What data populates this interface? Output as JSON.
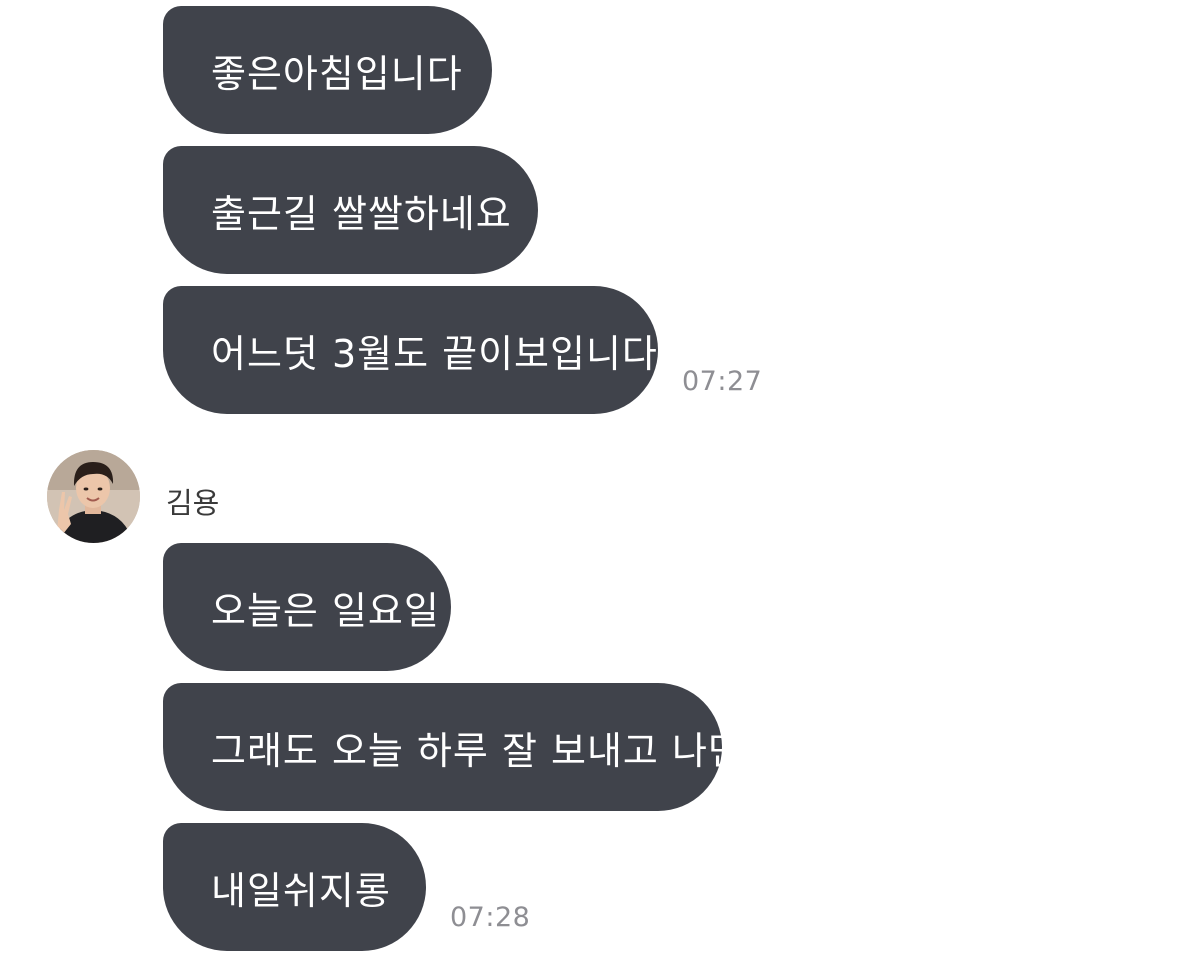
{
  "chat": {
    "group1": {
      "messages": [
        {
          "text": "좋은아침입니다"
        },
        {
          "text": "출근길 쌀쌀하네요"
        },
        {
          "text": "어느덧 3월도 끝이보입니다"
        }
      ],
      "time": "07:27"
    },
    "group2": {
      "sender": "김용",
      "messages": [
        {
          "text": "오늘은 일요일"
        },
        {
          "text": "그래도 오늘 하루 잘 보내고 나면"
        },
        {
          "text": "내일쉬지롱"
        }
      ],
      "time": "07:28"
    }
  },
  "colors": {
    "bubble": "#40434b",
    "bubble_text": "#ffffff",
    "timestamp": "#8e8e93",
    "background": "#ffffff"
  }
}
